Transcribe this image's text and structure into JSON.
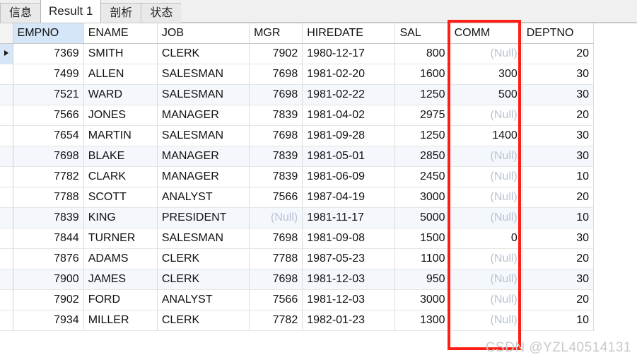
{
  "tabs": [
    {
      "label": "信息",
      "active": false
    },
    {
      "label": "Result 1",
      "active": true
    },
    {
      "label": "剖析",
      "active": false
    },
    {
      "label": "状态",
      "active": false
    }
  ],
  "grid": {
    "selected_column": "EMPNO",
    "current_row_index": 0,
    "null_text": "(Null)",
    "columns": [
      {
        "key": "EMPNO",
        "label": "EMPNO",
        "align": "num"
      },
      {
        "key": "ENAME",
        "label": "ENAME",
        "align": "txt"
      },
      {
        "key": "JOB",
        "label": "JOB",
        "align": "txt"
      },
      {
        "key": "MGR",
        "label": "MGR",
        "align": "num"
      },
      {
        "key": "HIREDATE",
        "label": "HIREDATE",
        "align": "txt"
      },
      {
        "key": "SAL",
        "label": "SAL",
        "align": "num"
      },
      {
        "key": "COMM",
        "label": "COMM",
        "align": "num"
      },
      {
        "key": "DEPTNO",
        "label": "DEPTNO",
        "align": "num"
      }
    ],
    "rows": [
      {
        "EMPNO": "7369",
        "ENAME": "SMITH",
        "JOB": "CLERK",
        "MGR": "7902",
        "HIREDATE": "1980-12-17",
        "SAL": "800",
        "COMM": "(Null)",
        "DEPTNO": "20"
      },
      {
        "EMPNO": "7499",
        "ENAME": "ALLEN",
        "JOB": "SALESMAN",
        "MGR": "7698",
        "HIREDATE": "1981-02-20",
        "SAL": "1600",
        "COMM": "300",
        "DEPTNO": "30"
      },
      {
        "EMPNO": "7521",
        "ENAME": "WARD",
        "JOB": "SALESMAN",
        "MGR": "7698",
        "HIREDATE": "1981-02-22",
        "SAL": "1250",
        "COMM": "500",
        "DEPTNO": "30"
      },
      {
        "EMPNO": "7566",
        "ENAME": "JONES",
        "JOB": "MANAGER",
        "MGR": "7839",
        "HIREDATE": "1981-04-02",
        "SAL": "2975",
        "COMM": "(Null)",
        "DEPTNO": "20"
      },
      {
        "EMPNO": "7654",
        "ENAME": "MARTIN",
        "JOB": "SALESMAN",
        "MGR": "7698",
        "HIREDATE": "1981-09-28",
        "SAL": "1250",
        "COMM": "1400",
        "DEPTNO": "30"
      },
      {
        "EMPNO": "7698",
        "ENAME": "BLAKE",
        "JOB": "MANAGER",
        "MGR": "7839",
        "HIREDATE": "1981-05-01",
        "SAL": "2850",
        "COMM": "(Null)",
        "DEPTNO": "30"
      },
      {
        "EMPNO": "7782",
        "ENAME": "CLARK",
        "JOB": "MANAGER",
        "MGR": "7839",
        "HIREDATE": "1981-06-09",
        "SAL": "2450",
        "COMM": "(Null)",
        "DEPTNO": "10"
      },
      {
        "EMPNO": "7788",
        "ENAME": "SCOTT",
        "JOB": "ANALYST",
        "MGR": "7566",
        "HIREDATE": "1987-04-19",
        "SAL": "3000",
        "COMM": "(Null)",
        "DEPTNO": "20"
      },
      {
        "EMPNO": "7839",
        "ENAME": "KING",
        "JOB": "PRESIDENT",
        "MGR": "(Null)",
        "HIREDATE": "1981-11-17",
        "SAL": "5000",
        "COMM": "(Null)",
        "DEPTNO": "10"
      },
      {
        "EMPNO": "7844",
        "ENAME": "TURNER",
        "JOB": "SALESMAN",
        "MGR": "7698",
        "HIREDATE": "1981-09-08",
        "SAL": "1500",
        "COMM": "0",
        "DEPTNO": "30"
      },
      {
        "EMPNO": "7876",
        "ENAME": "ADAMS",
        "JOB": "CLERK",
        "MGR": "7788",
        "HIREDATE": "1987-05-23",
        "SAL": "1100",
        "COMM": "(Null)",
        "DEPTNO": "20"
      },
      {
        "EMPNO": "7900",
        "ENAME": "JAMES",
        "JOB": "CLERK",
        "MGR": "7698",
        "HIREDATE": "1981-12-03",
        "SAL": "950",
        "COMM": "(Null)",
        "DEPTNO": "30"
      },
      {
        "EMPNO": "7902",
        "ENAME": "FORD",
        "JOB": "ANALYST",
        "MGR": "7566",
        "HIREDATE": "1981-12-03",
        "SAL": "3000",
        "COMM": "(Null)",
        "DEPTNO": "20"
      },
      {
        "EMPNO": "7934",
        "ENAME": "MILLER",
        "JOB": "CLERK",
        "MGR": "7782",
        "HIREDATE": "1982-01-23",
        "SAL": "1300",
        "COMM": "(Null)",
        "DEPTNO": "10"
      }
    ]
  },
  "annotation": {
    "target_column": "COMM",
    "color": "#fd1f15"
  },
  "watermark": {
    "text": "CSDN @YZL40514131"
  }
}
